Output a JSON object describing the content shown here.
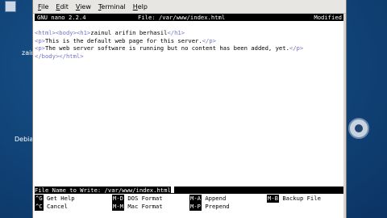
{
  "desktop": {
    "labels": [
      "zainu",
      "Debian"
    ]
  },
  "menubar": {
    "items": [
      {
        "label": "File",
        "accel": "F",
        "rest": "ile"
      },
      {
        "label": "Edit",
        "accel": "E",
        "rest": "dit"
      },
      {
        "label": "View",
        "accel": "V",
        "rest": "iew"
      },
      {
        "label": "Terminal",
        "accel": "T",
        "rest": "erminal"
      },
      {
        "label": "Help",
        "accel": "H",
        "rest": "elp"
      }
    ]
  },
  "nano": {
    "version": "GNU nano 2.2.4",
    "file": "File: /var/www/index.html",
    "status": "Modified",
    "lines": [
      {
        "tag1": "<html><body><h1>",
        "text": "zainul arifin berhasil",
        "tag2": "</h1>"
      },
      {
        "tag1": "<p>",
        "text": "This is the default web page for this server.",
        "tag2": "</p>"
      },
      {
        "tag1": "<p>",
        "text": "The web server software is running but no content has been added, yet.",
        "tag2": "</p>"
      },
      {
        "tag1": "</body></html>",
        "text": "",
        "tag2": ""
      }
    ],
    "prompt": "File Name to Write: /var/www/index.html",
    "shortcuts": [
      {
        "key": "^G",
        "label": "Get Help"
      },
      {
        "key": "M-D",
        "label": "DOS Format"
      },
      {
        "key": "M-A",
        "label": "Append"
      },
      {
        "key": "M-B",
        "label": "Backup File"
      },
      {
        "key": "^C",
        "label": "Cancel"
      },
      {
        "key": "M-M",
        "label": "Mac Format"
      },
      {
        "key": "M-P",
        "label": "Prepend"
      }
    ]
  }
}
